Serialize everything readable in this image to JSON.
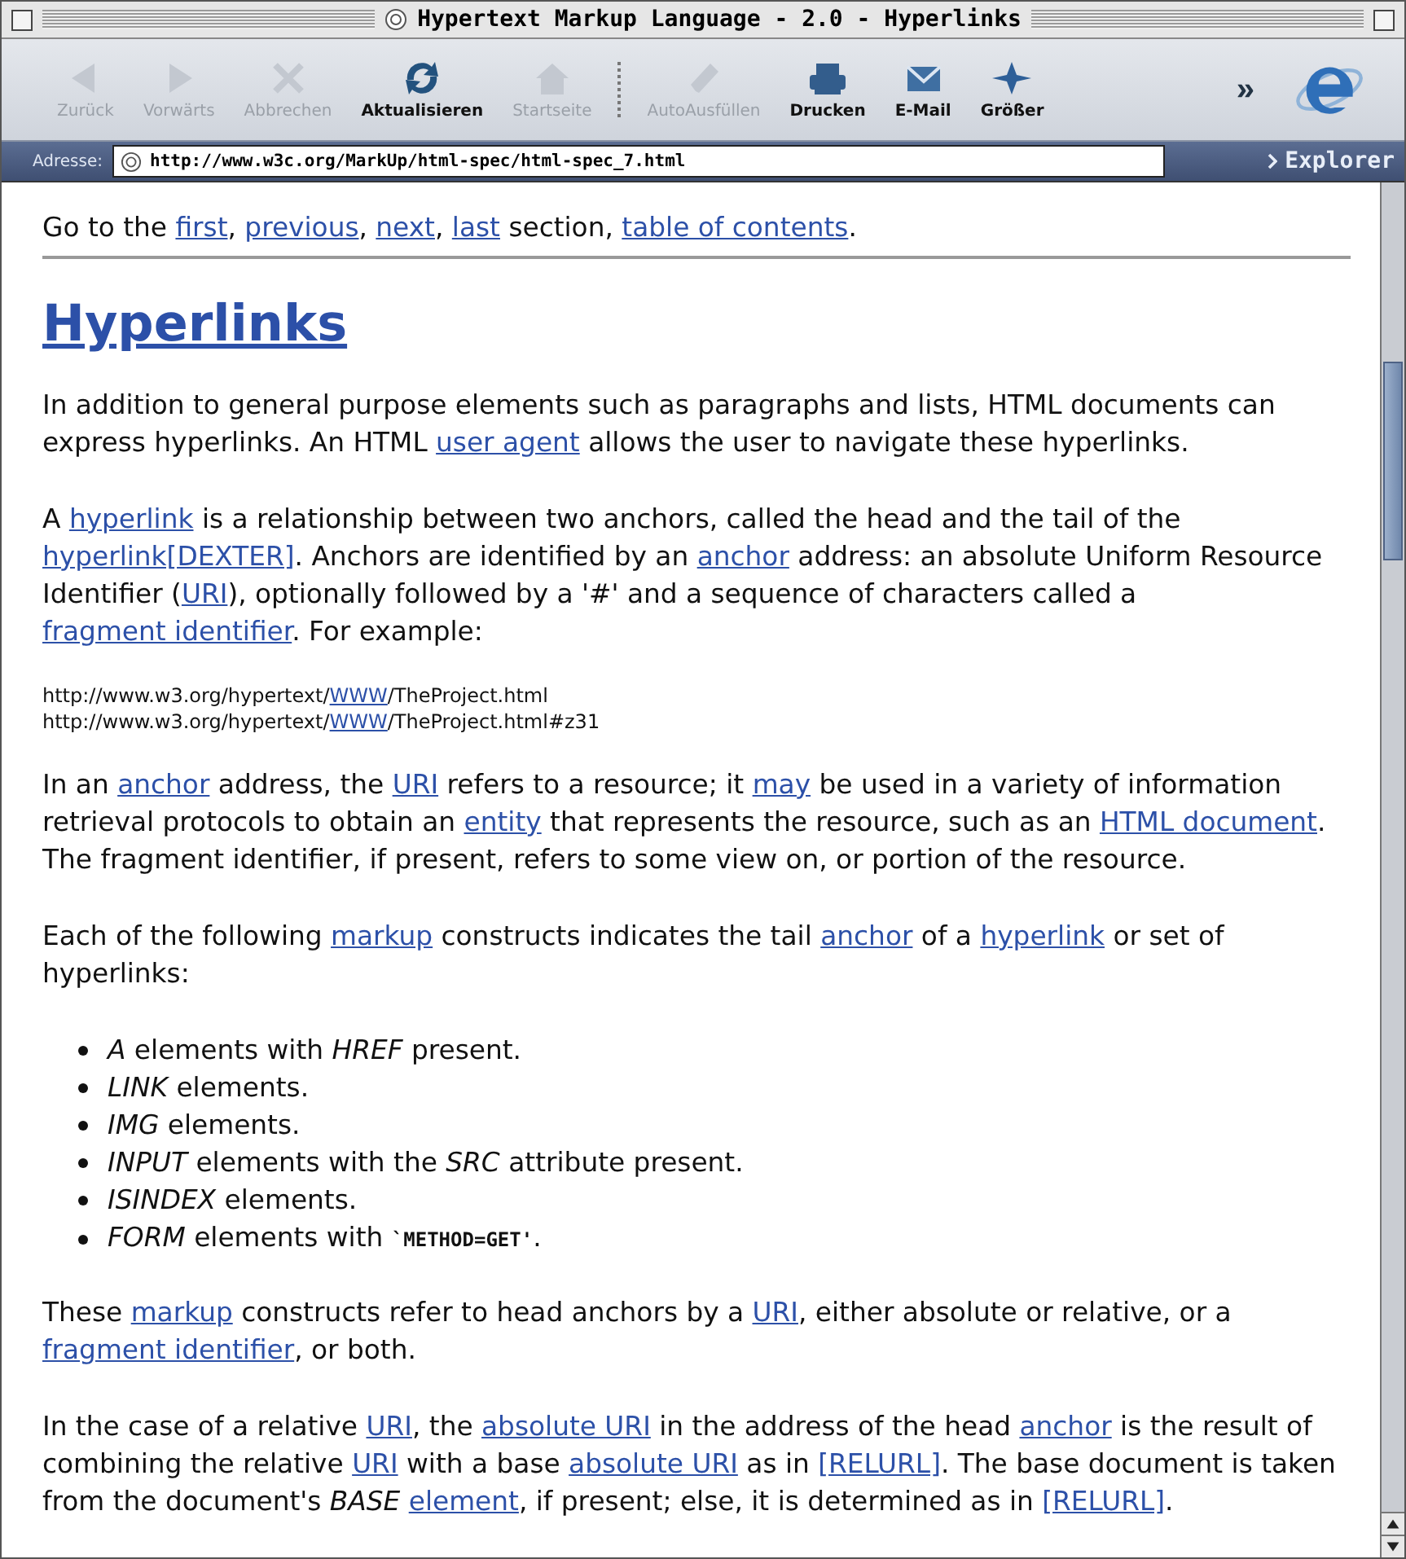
{
  "window": {
    "title": "Hypertext Markup Language - 2.0  - Hyperlinks"
  },
  "toolbar": [
    {
      "label": "Zurück",
      "disabled": true
    },
    {
      "label": "Vorwärts",
      "disabled": true
    },
    {
      "label": "Abbrechen",
      "disabled": true
    },
    {
      "label": "Aktualisieren",
      "disabled": false
    },
    {
      "label": "Startseite",
      "disabled": true
    },
    {
      "label": "AutoAusfüllen",
      "disabled": true
    },
    {
      "label": "Drucken",
      "disabled": false
    },
    {
      "label": "E-Mail",
      "disabled": false
    },
    {
      "label": "Größer",
      "disabled": false
    }
  ],
  "toolbar_more": "»",
  "address": {
    "label": "Adresse:",
    "value": "http://www.w3c.org/MarkUp/html-spec/html-spec_7.html",
    "explorer_tab": "Explorer"
  },
  "page": {
    "nav": [
      {
        "kind": "text",
        "text": "Go to the "
      },
      {
        "kind": "link",
        "text": "first"
      },
      {
        "kind": "text",
        "text": ", "
      },
      {
        "kind": "link",
        "text": "previous"
      },
      {
        "kind": "text",
        "text": ", "
      },
      {
        "kind": "link",
        "text": "next"
      },
      {
        "kind": "text",
        "text": ", "
      },
      {
        "kind": "link",
        "text": "last"
      },
      {
        "kind": "text",
        "text": " section, "
      },
      {
        "kind": "link",
        "text": "table of contents"
      },
      {
        "kind": "text",
        "text": "."
      }
    ],
    "heading": "Hyperlinks",
    "blocks": [
      {
        "kind": "paragraph",
        "parts": [
          {
            "kind": "text",
            "text": "In addition to general purpose elements such as paragraphs and lists, HTML documents can express hyperlinks. An HTML "
          },
          {
            "kind": "link",
            "text": "user agent"
          },
          {
            "kind": "text",
            "text": " allows the user to navigate these hyperlinks."
          }
        ]
      },
      {
        "kind": "paragraph",
        "parts": [
          {
            "kind": "text",
            "text": "A "
          },
          {
            "kind": "link",
            "text": "hyperlink"
          },
          {
            "kind": "text",
            "text": " is a relationship between two anchors, called the head and the tail of the "
          },
          {
            "kind": "link",
            "text": "hyperlink[DEXTER]"
          },
          {
            "kind": "text",
            "text": ". Anchors are identified by an "
          },
          {
            "kind": "link",
            "text": "anchor"
          },
          {
            "kind": "text",
            "text": " address: an absolute Uniform Resource Identifier ("
          },
          {
            "kind": "link",
            "text": "URI"
          },
          {
            "kind": "text",
            "text": "), optionally followed by a '#' and a sequence of characters called a "
          },
          {
            "kind": "link",
            "text": "fragment identifier"
          },
          {
            "kind": "text",
            "text": ". For example:"
          }
        ]
      },
      {
        "kind": "example",
        "lines": [
          [
            {
              "kind": "text",
              "text": "http://www.w3.org/hypertext/"
            },
            {
              "kind": "link",
              "text": "WWW"
            },
            {
              "kind": "text",
              "text": "/TheProject.html"
            }
          ],
          [
            {
              "kind": "text",
              "text": "http://www.w3.org/hypertext/"
            },
            {
              "kind": "link",
              "text": "WWW"
            },
            {
              "kind": "text",
              "text": "/TheProject.html#z31"
            }
          ]
        ]
      },
      {
        "kind": "paragraph",
        "parts": [
          {
            "kind": "text",
            "text": "In an "
          },
          {
            "kind": "link",
            "text": "anchor"
          },
          {
            "kind": "text",
            "text": " address, the "
          },
          {
            "kind": "link",
            "text": "URI"
          },
          {
            "kind": "text",
            "text": " refers to a resource; it "
          },
          {
            "kind": "link",
            "text": "may"
          },
          {
            "kind": "text",
            "text": " be used in a variety of information retrieval protocols to obtain an "
          },
          {
            "kind": "link",
            "text": "entity"
          },
          {
            "kind": "text",
            "text": " that represents the resource, such as an "
          },
          {
            "kind": "link",
            "text": "HTML document"
          },
          {
            "kind": "text",
            "text": ". The fragment identifier, if present, refers to some view on, or portion of the resource."
          }
        ]
      },
      {
        "kind": "paragraph",
        "parts": [
          {
            "kind": "text",
            "text": "Each of the following "
          },
          {
            "kind": "link",
            "text": "markup"
          },
          {
            "kind": "text",
            "text": " constructs indicates the tail "
          },
          {
            "kind": "link",
            "text": "anchor"
          },
          {
            "kind": "text",
            "text": " of a "
          },
          {
            "kind": "link",
            "text": "hyperlink"
          },
          {
            "kind": "text",
            "text": " or set of hyperlinks:"
          }
        ]
      },
      {
        "kind": "list",
        "items": [
          [
            {
              "kind": "em",
              "text": "A"
            },
            {
              "kind": "text",
              "text": " elements with "
            },
            {
              "kind": "em",
              "text": "HREF"
            },
            {
              "kind": "text",
              "text": " present."
            }
          ],
          [
            {
              "kind": "em",
              "text": "LINK"
            },
            {
              "kind": "text",
              "text": " elements."
            }
          ],
          [
            {
              "kind": "em",
              "text": "IMG"
            },
            {
              "kind": "text",
              "text": " elements."
            }
          ],
          [
            {
              "kind": "em",
              "text": "INPUT"
            },
            {
              "kind": "text",
              "text": " elements with the "
            },
            {
              "kind": "em",
              "text": "SRC"
            },
            {
              "kind": "text",
              "text": " attribute present."
            }
          ],
          [
            {
              "kind": "em",
              "text": "ISINDEX"
            },
            {
              "kind": "text",
              "text": " elements."
            }
          ],
          [
            {
              "kind": "em",
              "text": "FORM"
            },
            {
              "kind": "text",
              "text": " elements with "
            },
            {
              "kind": "code",
              "text": "`METHOD=GET'"
            },
            {
              "kind": "text",
              "text": "."
            }
          ]
        ]
      },
      {
        "kind": "paragraph",
        "parts": [
          {
            "kind": "text",
            "text": "These "
          },
          {
            "kind": "link",
            "text": "markup"
          },
          {
            "kind": "text",
            "text": " constructs refer to head anchors by a "
          },
          {
            "kind": "link",
            "text": "URI"
          },
          {
            "kind": "text",
            "text": ", either absolute or relative, or a "
          },
          {
            "kind": "link",
            "text": "fragment identifier"
          },
          {
            "kind": "text",
            "text": ", or both."
          }
        ]
      },
      {
        "kind": "paragraph",
        "parts": [
          {
            "kind": "text",
            "text": "In the case of a relative "
          },
          {
            "kind": "link",
            "text": "URI"
          },
          {
            "kind": "text",
            "text": ", the "
          },
          {
            "kind": "link",
            "text": "absolute URI"
          },
          {
            "kind": "text",
            "text": " in the address of the head "
          },
          {
            "kind": "link",
            "text": "anchor"
          },
          {
            "kind": "text",
            "text": " is the result of combining the relative "
          },
          {
            "kind": "link",
            "text": "URI"
          },
          {
            "kind": "text",
            "text": " with a base "
          },
          {
            "kind": "link",
            "text": "absolute URI"
          },
          {
            "kind": "text",
            "text": " as in "
          },
          {
            "kind": "link",
            "text": "[RELURL]"
          },
          {
            "kind": "text",
            "text": ". The base document is taken from the document's "
          },
          {
            "kind": "em",
            "text": "BASE "
          },
          {
            "kind": "link",
            "text": "element"
          },
          {
            "kind": "text",
            "text": ", if present; else, it is determined as in "
          },
          {
            "kind": "link",
            "text": "[RELURL]"
          },
          {
            "kind": "text",
            "text": "."
          }
        ]
      }
    ]
  }
}
